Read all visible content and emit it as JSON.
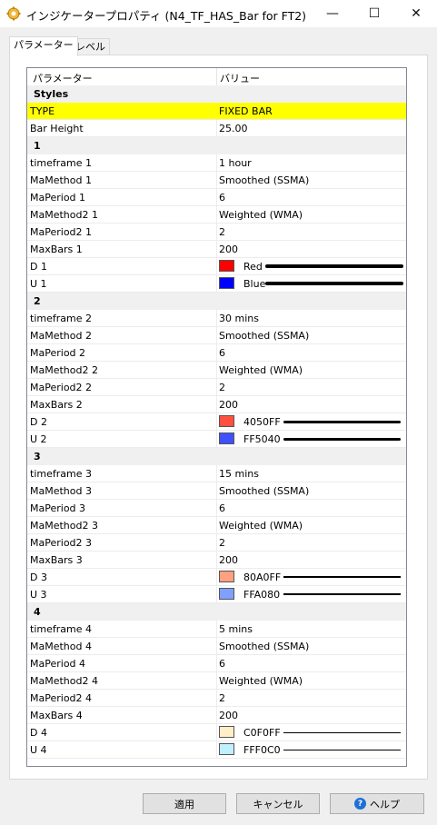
{
  "window": {
    "title": "インジケータープロパティ (N4_TF_HAS_Bar for FT2)",
    "icon": "gear-icon",
    "minimize_glyph": "—",
    "maximize_glyph": "☐",
    "close_glyph": "✕"
  },
  "tabs": [
    {
      "label": "パラメーター",
      "active": true
    },
    {
      "label": "レベル",
      "active": false
    }
  ],
  "grid": {
    "col_param": "パラメーター",
    "col_value": "バリュー",
    "rows": [
      {
        "type": "cat",
        "name": "Styles"
      },
      {
        "type": "param",
        "name": "TYPE",
        "value": "FIXED BAR",
        "highlight": true
      },
      {
        "type": "param",
        "name": "Bar Height",
        "value": "25.00"
      },
      {
        "type": "cat",
        "name": "1"
      },
      {
        "type": "param",
        "name": "timeframe 1",
        "value": "1 hour"
      },
      {
        "type": "param",
        "name": "MaMethod 1",
        "value": "Smoothed (SSMA)"
      },
      {
        "type": "param",
        "name": "MaPeriod 1",
        "value": "6"
      },
      {
        "type": "param",
        "name": "MaMethod2 1",
        "value": "Weighted (WMA)"
      },
      {
        "type": "param",
        "name": "MaPeriod2 1",
        "value": "2"
      },
      {
        "type": "param",
        "name": "MaxBars 1",
        "value": "200"
      },
      {
        "type": "color",
        "name": "D 1",
        "color": "#ff0000",
        "label": "Red",
        "line": 4
      },
      {
        "type": "color",
        "name": "U 1",
        "color": "#0000ff",
        "label": "Blue",
        "line": 4
      },
      {
        "type": "cat",
        "name": "2"
      },
      {
        "type": "param",
        "name": "timeframe 2",
        "value": "30 mins"
      },
      {
        "type": "param",
        "name": "MaMethod 2",
        "value": "Smoothed (SSMA)"
      },
      {
        "type": "param",
        "name": "MaPeriod 2",
        "value": "6"
      },
      {
        "type": "param",
        "name": "MaMethod2 2",
        "value": "Weighted (WMA)"
      },
      {
        "type": "param",
        "name": "MaPeriod2 2",
        "value": "2"
      },
      {
        "type": "param",
        "name": "MaxBars 2",
        "value": "200"
      },
      {
        "type": "color",
        "name": "D 2",
        "color": "#ff5040",
        "label": "4050FF",
        "line": 3
      },
      {
        "type": "color",
        "name": "U 2",
        "color": "#4050ff",
        "label": "FF5040",
        "line": 3
      },
      {
        "type": "cat",
        "name": "3"
      },
      {
        "type": "param",
        "name": "timeframe 3",
        "value": "15 mins"
      },
      {
        "type": "param",
        "name": "MaMethod 3",
        "value": "Smoothed (SSMA)"
      },
      {
        "type": "param",
        "name": "MaPeriod 3",
        "value": "6"
      },
      {
        "type": "param",
        "name": "MaMethod2 3",
        "value": "Weighted (WMA)"
      },
      {
        "type": "param",
        "name": "MaPeriod2 3",
        "value": "2"
      },
      {
        "type": "param",
        "name": "MaxBars 3",
        "value": "200"
      },
      {
        "type": "color",
        "name": "D 3",
        "color": "#ffa080",
        "label": "80A0FF",
        "line": 2
      },
      {
        "type": "color",
        "name": "U 3",
        "color": "#80a0ff",
        "label": "FFA080",
        "line": 2
      },
      {
        "type": "cat",
        "name": "4"
      },
      {
        "type": "param",
        "name": "timeframe 4",
        "value": "5 mins"
      },
      {
        "type": "param",
        "name": "MaMethod 4",
        "value": "Smoothed (SSMA)"
      },
      {
        "type": "param",
        "name": "MaPeriod 4",
        "value": "6"
      },
      {
        "type": "param",
        "name": "MaMethod2 4",
        "value": "Weighted (WMA)"
      },
      {
        "type": "param",
        "name": "MaPeriod2 4",
        "value": "2"
      },
      {
        "type": "param",
        "name": "MaxBars 4",
        "value": "200"
      },
      {
        "type": "color",
        "name": "D 4",
        "color": "#ffeec8",
        "label": "C0F0FF",
        "line": 1
      },
      {
        "type": "color",
        "name": "U 4",
        "color": "#c0f0ff",
        "label": "FFF0C0",
        "line": 1
      }
    ]
  },
  "buttons": {
    "apply": "適用",
    "cancel": "キャンセル",
    "help": "ヘルプ",
    "help_glyph": "?"
  }
}
